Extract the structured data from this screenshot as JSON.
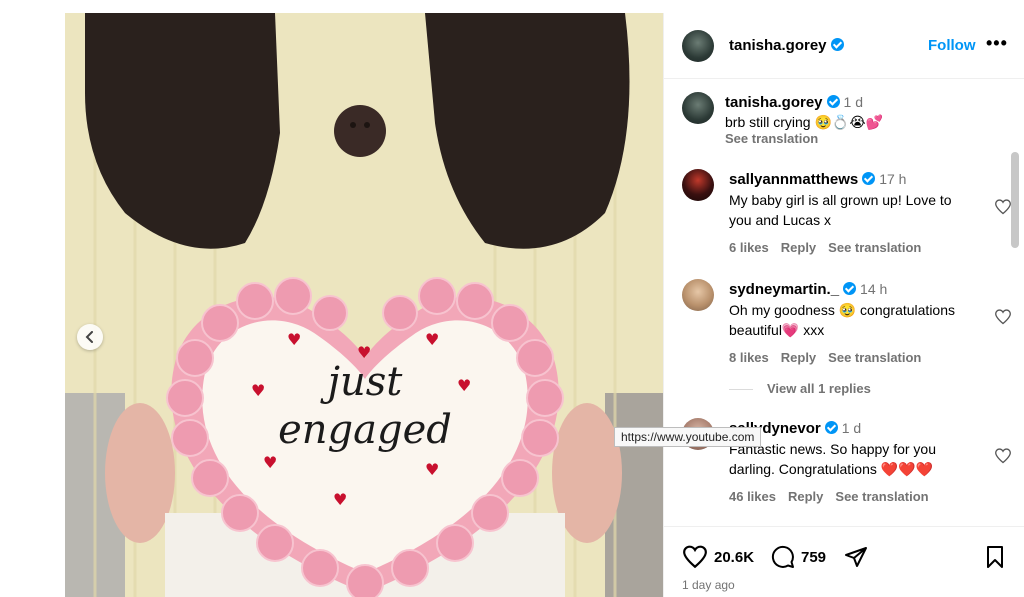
{
  "post": {
    "author": "tanisha.gorey",
    "follow_label": "Follow",
    "more_label": "•••",
    "caption": {
      "username": "tanisha.gorey",
      "time": "1 d",
      "text": "brb still crying 🥹💍😭💕",
      "see_translation": "See translation"
    }
  },
  "comments": [
    {
      "username": "sallyannmatthews",
      "time": "17 h",
      "text": "My baby girl is all grown up! Love to you and Lucas x",
      "likes": "6 likes",
      "reply": "Reply",
      "see_translation": "See translation"
    },
    {
      "username": "sydneymartin._",
      "time": "14 h",
      "text": "Oh my goodness 🥹 congratulations beautiful💗 xxx",
      "likes": "8 likes",
      "reply": "Reply",
      "see_translation": "See translation",
      "view_replies": "View all 1 replies"
    },
    {
      "username": "sallydynevor",
      "time": "1 d",
      "text": "Fantastic news. So happy for you darling. Congratulations ❤️❤️❤️",
      "likes": "46 likes",
      "reply": "Reply",
      "see_translation": "See translation"
    }
  ],
  "tooltip": "https://www.youtube.com",
  "actions": {
    "likes_count": "20.6K",
    "comments_count": "759",
    "posted_ago": "1 day ago"
  },
  "photo": {
    "cake_text_line1": "just",
    "cake_text_line2": "engaged"
  },
  "colors": {
    "accent": "#0095f6",
    "muted": "#737373",
    "frosting": "#f2a7b8",
    "heart_red": "#c8102e"
  }
}
